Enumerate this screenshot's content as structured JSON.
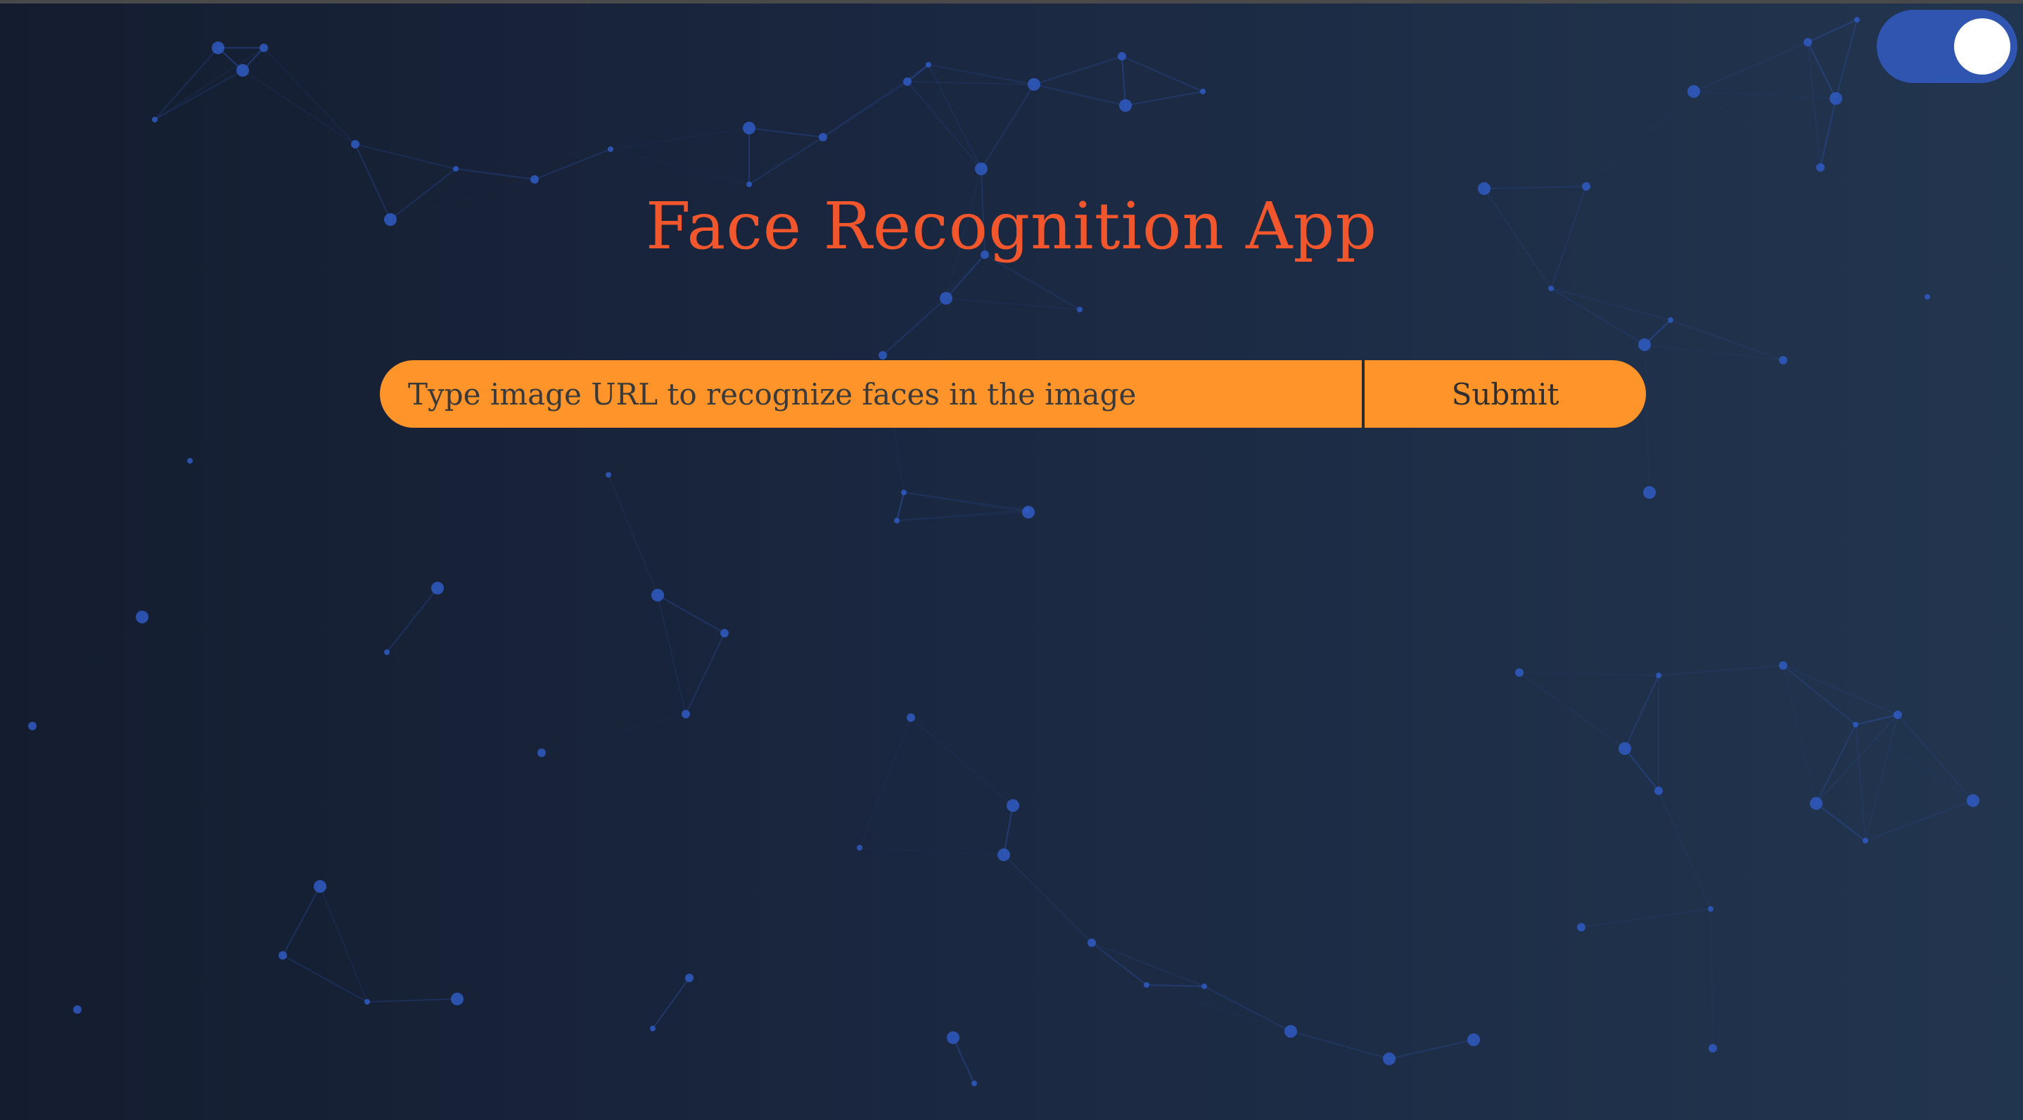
{
  "app": {
    "title": "Face Recognition App"
  },
  "theme_toggle": {
    "state": "on",
    "track_color": "#2f55b0",
    "knob_color": "#ffffff"
  },
  "form": {
    "url_placeholder": "Type image URL to recognize faces in the image",
    "url_value": "",
    "submit_label": "Submit"
  },
  "colors": {
    "title": "#f2562c",
    "input_background": "#ff952a",
    "background_left": "#141d2f",
    "background_right": "#22354f",
    "network_lines": "#2f5ac2"
  }
}
